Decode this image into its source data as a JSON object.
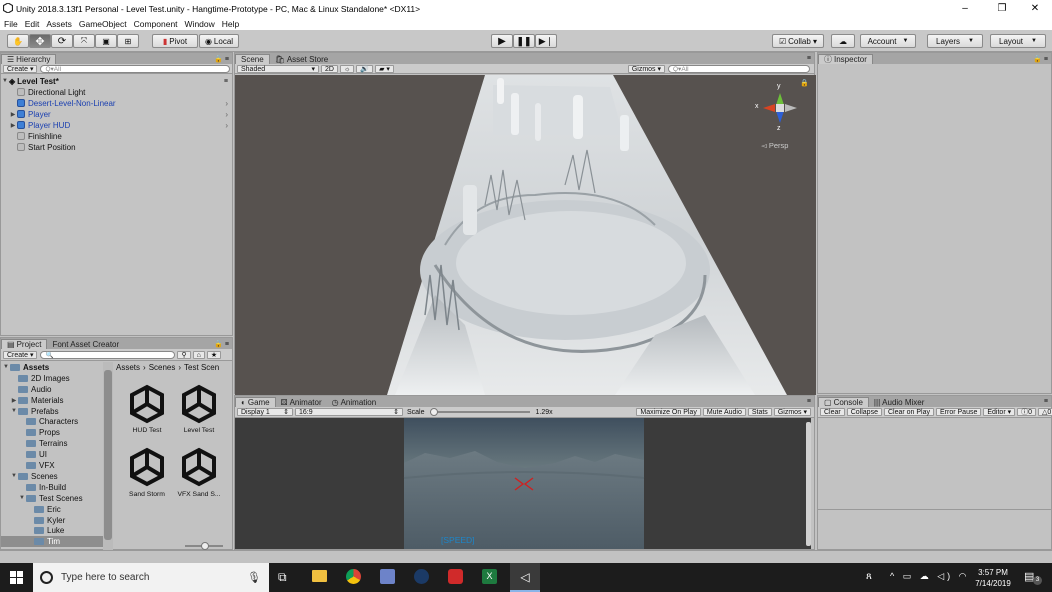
{
  "window": {
    "title": "Unity 2018.3.13f1 Personal - Level Test.unity - Hangtime-Prototype - PC, Mac & Linux Standalone* <DX11>",
    "minimize": "–",
    "maximize": "❐",
    "close": "✕"
  },
  "menu": [
    "File",
    "Edit",
    "Assets",
    "GameObject",
    "Component",
    "Window",
    "Help"
  ],
  "toolbar": {
    "pivot": "Pivot",
    "local": "Local",
    "collab": "Collab ▾",
    "account": "Account",
    "layers": "Layers",
    "layout": "Layout"
  },
  "hierarchy": {
    "tab": "Hierarchy",
    "create": "Create ▾",
    "search_placeholder": "Q▾All",
    "scene_name": "Level Test*",
    "items": [
      {
        "label": "Directional Light",
        "blue": false,
        "expandable": false,
        "child": false
      },
      {
        "label": "Desert-Level-Non-Linear",
        "blue": true,
        "expandable": false,
        "child": true
      },
      {
        "label": "Player",
        "blue": true,
        "expandable": true,
        "child": true
      },
      {
        "label": "Player HUD",
        "blue": true,
        "expandable": true,
        "child": true
      },
      {
        "label": "Finishline",
        "blue": false,
        "expandable": false,
        "child": false
      },
      {
        "label": "Start Position",
        "blue": false,
        "expandable": false,
        "child": false
      }
    ]
  },
  "scene": {
    "tabs": [
      "Scene",
      "Asset Store"
    ],
    "shading": "Shaded",
    "mode_2d": "2D",
    "gizmos": "Gizmos ▾",
    "search_placeholder": "Q▾All",
    "persp": "◅ Persp",
    "axis_y": "y",
    "axis_x": "x",
    "axis_z": "z"
  },
  "inspector": {
    "tab": "Inspector"
  },
  "project": {
    "tabs": [
      "Project",
      "Font Asset Creator"
    ],
    "create": "Create ▾",
    "breadcrumb": [
      "Assets",
      "Scenes",
      "Test Scen"
    ],
    "tree": [
      {
        "label": "Assets",
        "bold": true,
        "indent": 0,
        "arrow": "▼"
      },
      {
        "label": "2D Images",
        "bold": false,
        "indent": 1,
        "arrow": ""
      },
      {
        "label": "Audio",
        "bold": false,
        "indent": 1,
        "arrow": ""
      },
      {
        "label": "Materials",
        "bold": false,
        "indent": 1,
        "arrow": "▶"
      },
      {
        "label": "Prefabs",
        "bold": false,
        "indent": 1,
        "arrow": "▼"
      },
      {
        "label": "Characters",
        "bold": false,
        "indent": 2,
        "arrow": ""
      },
      {
        "label": "Props",
        "bold": false,
        "indent": 2,
        "arrow": ""
      },
      {
        "label": "Terrains",
        "bold": false,
        "indent": 2,
        "arrow": ""
      },
      {
        "label": "UI",
        "bold": false,
        "indent": 2,
        "arrow": ""
      },
      {
        "label": "VFX",
        "bold": false,
        "indent": 2,
        "arrow": ""
      },
      {
        "label": "Scenes",
        "bold": false,
        "indent": 1,
        "arrow": "▼"
      },
      {
        "label": "In-Build",
        "bold": false,
        "indent": 2,
        "arrow": ""
      },
      {
        "label": "Test Scenes",
        "bold": false,
        "indent": 2,
        "arrow": "▼"
      },
      {
        "label": "Eric",
        "bold": false,
        "indent": 3,
        "arrow": ""
      },
      {
        "label": "Kyler",
        "bold": false,
        "indent": 3,
        "arrow": ""
      },
      {
        "label": "Luke",
        "bold": false,
        "indent": 3,
        "arrow": ""
      },
      {
        "label": "Tim",
        "bold": false,
        "indent": 3,
        "arrow": ""
      }
    ],
    "assets": [
      "HUD Test",
      "Level Test",
      "Sand Storm",
      "VFX Sand S..."
    ]
  },
  "game": {
    "tabs": [
      "Game",
      "Animator",
      "Animation"
    ],
    "display": "Display 1",
    "aspect": "16:9",
    "scale_label": "Scale",
    "scale_value": "1.29x",
    "buttons": [
      "Maximize On Play",
      "Mute Audio",
      "Stats",
      "Gizmos ▾"
    ],
    "hud_text": "[SPEED]"
  },
  "console": {
    "tabs": [
      "Console",
      "Audio Mixer"
    ],
    "buttons": [
      "Clear",
      "Collapse",
      "Clear on Play",
      "Error Pause",
      "Editor ▾"
    ],
    "warnings": "0",
    "errors": "0"
  },
  "taskbar": {
    "search_placeholder": "Type here to search",
    "time": "3:57 PM",
    "date": "7/14/2019",
    "notif_count": "3"
  }
}
